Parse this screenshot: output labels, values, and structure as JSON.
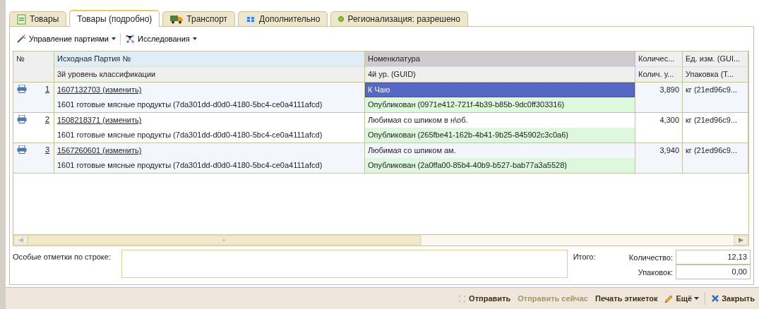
{
  "tabs": [
    {
      "label": "Товары",
      "selected": false
    },
    {
      "label": "Товары (подробно)",
      "selected": true
    },
    {
      "label": "Транспорт",
      "selected": false
    },
    {
      "label": "Дополнительно",
      "selected": false
    },
    {
      "label": "Регионализация: разрешено",
      "selected": false
    }
  ],
  "toolbar": [
    {
      "label": "Управление партиями"
    },
    {
      "label": "Исследования"
    }
  ],
  "table": {
    "columns": [
      {
        "top": "№",
        "selected": false
      },
      {
        "top": "Исходная Партия №",
        "bottom": "3й уровень классификации",
        "selected": false
      },
      {
        "top": "Номенклатура",
        "bottom": "4й ур. (GUID)",
        "selected": true
      },
      {
        "top": "Количес...",
        "bottom": "Колич. у...",
        "selected": false
      },
      {
        "top": "Ед. изм. (GUI...",
        "bottom": "Упаковка (Т...",
        "selected": false
      }
    ],
    "rows": [
      {
        "number": "1",
        "batch": "1607132703 (изменить)",
        "classification": "1601 готовые мясные продукты (7da301dd-d0d0-4180-5bc4-ce0a4111afcd)",
        "nomenclature": "К Чаю",
        "status": "Опубликован (0971e412-721f-4b39-b85b-9dc0ff303316)",
        "quantity": "3,890",
        "unit": "кг (21ed96c9...",
        "selected": true
      },
      {
        "number": "2",
        "batch": "1508218371 (изменить)",
        "classification": "1601 готовые мясные продукты (7da301dd-d0d0-4180-5bc4-ce0a4111afcd)",
        "nomenclature": "Любимая со шпиком в н\\об.",
        "status": "Опубликован (265fbe41-162b-4b41-9b25-845902c3c0a6)",
        "quantity": "4,300",
        "unit": "кг (21ed96c9...",
        "selected": false
      },
      {
        "number": "3",
        "batch": "1567260601 (изменить)",
        "classification": "1601 готовые мясные продукты (7da301dd-d0d0-4180-5bc4-ce0a4111afcd)",
        "nomenclature": "Любимая со шпиком ам.",
        "status": "Опубликован (2a0ffa00-85b4-40b9-b527-bab77a3a5528)",
        "quantity": "3,940",
        "unit": "кг (21ed96c9...",
        "selected": false
      }
    ]
  },
  "notes": {
    "label": "Особые отметки по строке:"
  },
  "totals": {
    "label": "Итого:",
    "fields": [
      {
        "label": "Количество:",
        "value": "12,13"
      },
      {
        "label": "Упаковок:",
        "value": "0,00"
      }
    ]
  },
  "actions": [
    {
      "label": "Отправить",
      "disabled": false
    },
    {
      "label": "Отправить сейчас",
      "disabled": true
    },
    {
      "label": "Печать этикеток",
      "disabled": false
    },
    {
      "label": "Ещё",
      "disabled": false
    },
    {
      "label": "Закрыть",
      "disabled": false
    }
  ]
}
